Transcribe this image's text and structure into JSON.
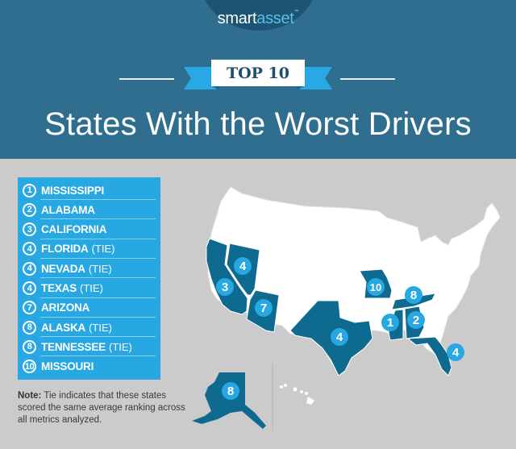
{
  "brand": {
    "part1": "smart",
    "part2": "asset",
    "tm": "™"
  },
  "banner": {
    "label": "TOP 10"
  },
  "title": "States With the Worst Drivers",
  "colors": {
    "header_bg": "#2f6e8f",
    "highlight_state": "#0e6a8e",
    "other_state": "#ffffff",
    "badge": "#27a8e3",
    "list_bg": "#27a8e3",
    "page_bg": "#cbcbcb"
  },
  "rankings": [
    {
      "rank": "1",
      "state": "MISSISSIPPI",
      "tie": ""
    },
    {
      "rank": "2",
      "state": "ALABAMA",
      "tie": ""
    },
    {
      "rank": "3",
      "state": "CALIFORNIA",
      "tie": ""
    },
    {
      "rank": "4",
      "state": "FLORIDA",
      "tie": "(TIE)"
    },
    {
      "rank": "4",
      "state": "NEVADA",
      "tie": "(TIE)"
    },
    {
      "rank": "4",
      "state": "TEXAS",
      "tie": "(TIE)"
    },
    {
      "rank": "7",
      "state": "ARIZONA",
      "tie": ""
    },
    {
      "rank": "8",
      "state": "ALASKA",
      "tie": "(TIE)"
    },
    {
      "rank": "8",
      "state": "TENNESSEE",
      "tie": "(TIE)"
    },
    {
      "rank": "10",
      "state": "MISSOURI",
      "tie": ""
    }
  ],
  "note": {
    "label": "Note:",
    "text": "Tie indicates that these states scored the same average ranking across all metrics analyzed."
  },
  "map_badges": [
    {
      "state": "Nevada",
      "rank": "4"
    },
    {
      "state": "California",
      "rank": "3"
    },
    {
      "state": "Arizona",
      "rank": "7"
    },
    {
      "state": "Texas",
      "rank": "4"
    },
    {
      "state": "Missouri",
      "rank": "10"
    },
    {
      "state": "Tennessee",
      "rank": "8"
    },
    {
      "state": "Mississippi",
      "rank": "1"
    },
    {
      "state": "Alabama",
      "rank": "2"
    },
    {
      "state": "Florida",
      "rank": "4"
    },
    {
      "state": "Alaska",
      "rank": "8"
    }
  ]
}
